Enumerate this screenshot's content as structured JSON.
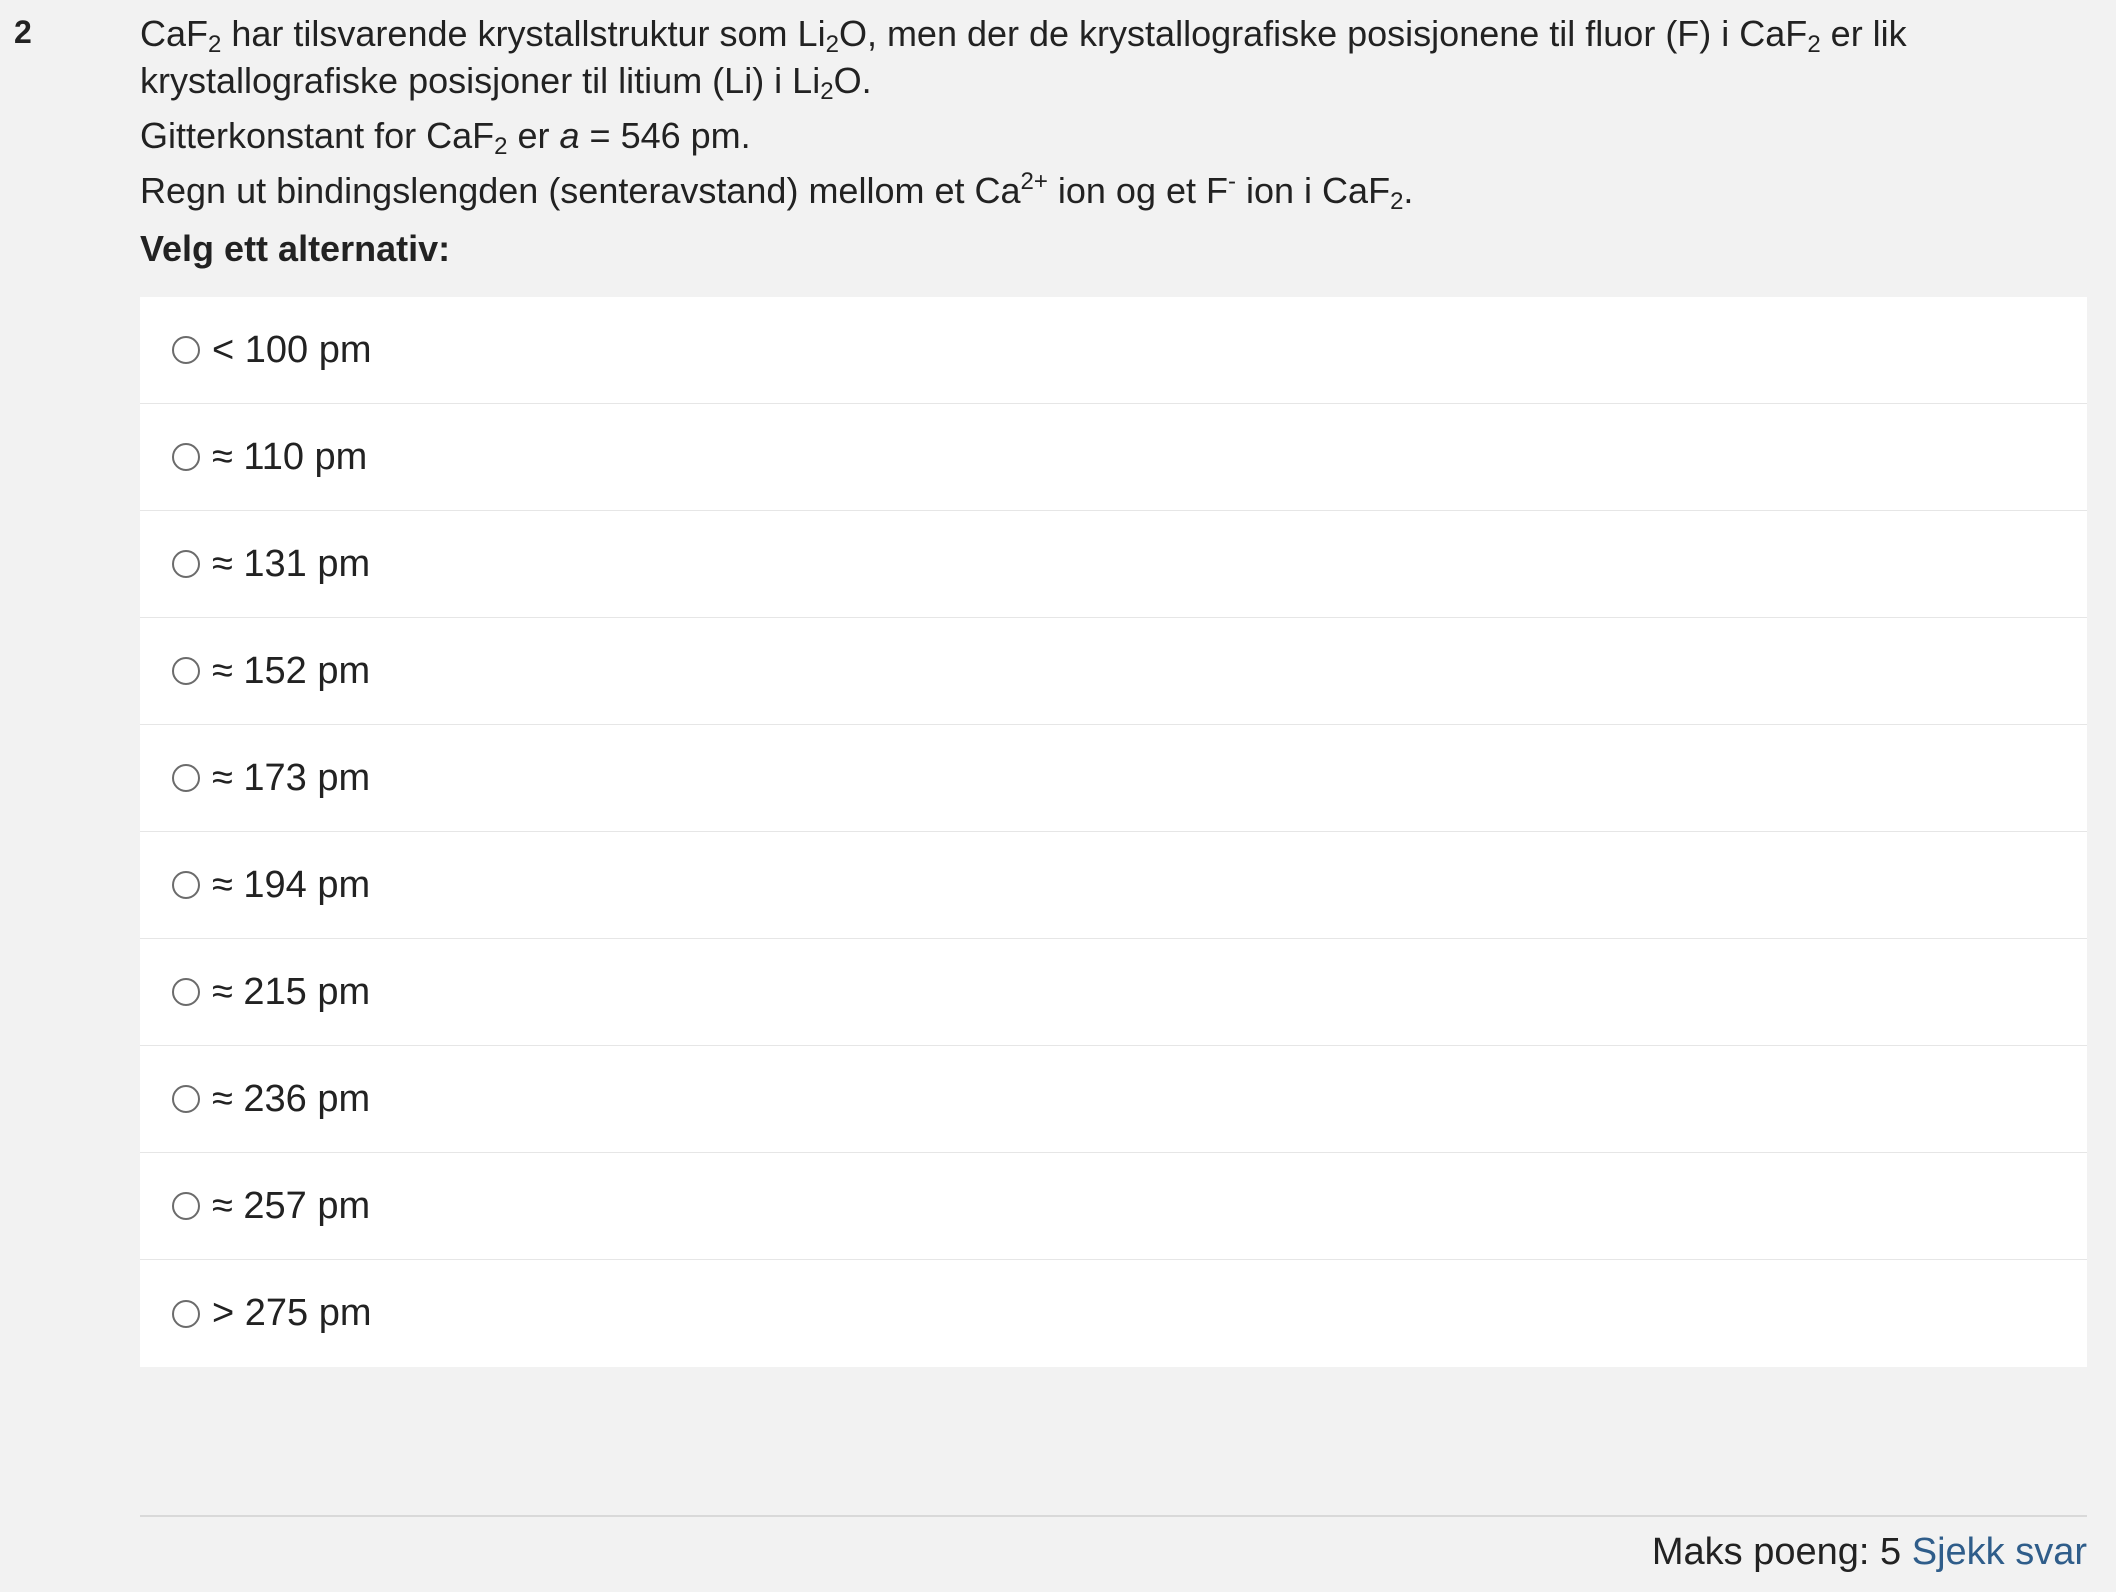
{
  "question": {
    "number": "2",
    "line1": {
      "t1": "CaF",
      "s1": "2",
      "t2": " har tilsvarende krystallstruktur som Li",
      "s2": "2",
      "t3": "O, men der de krystallografiske posisjonene til fluor (F) i CaF",
      "s3": "2",
      "t4": " er lik"
    },
    "line2": {
      "t1": "krystallografiske posisjoner til litium (Li) i Li",
      "s1": "2",
      "t2": "O."
    },
    "line3": {
      "t1": "Gitterkonstant for CaF",
      "s1": "2",
      "t2": " er ",
      "var": "a",
      "t3": " = 546 pm."
    },
    "line4": {
      "t1": "Regn ut bindingslengden (senteravstand) mellom et Ca",
      "sup1": "2+",
      "t2": " ion og et F",
      "sup2": "-",
      "t3": " ion i CaF",
      "s1": "2",
      "t4": "."
    },
    "prompt": "Velg ett alternativ:"
  },
  "options": [
    "< 100 pm",
    "≈ 110 pm",
    "≈ 131 pm",
    "≈ 152 pm",
    "≈ 173 pm",
    "≈ 194 pm",
    "≈ 215 pm",
    "≈ 236 pm",
    "≈ 257 pm",
    "> 275 pm"
  ],
  "footer": {
    "max_points_label": "Maks poeng: 5",
    "check_button": "Sjekk svar",
    "link_color": "#2f5d8a"
  }
}
